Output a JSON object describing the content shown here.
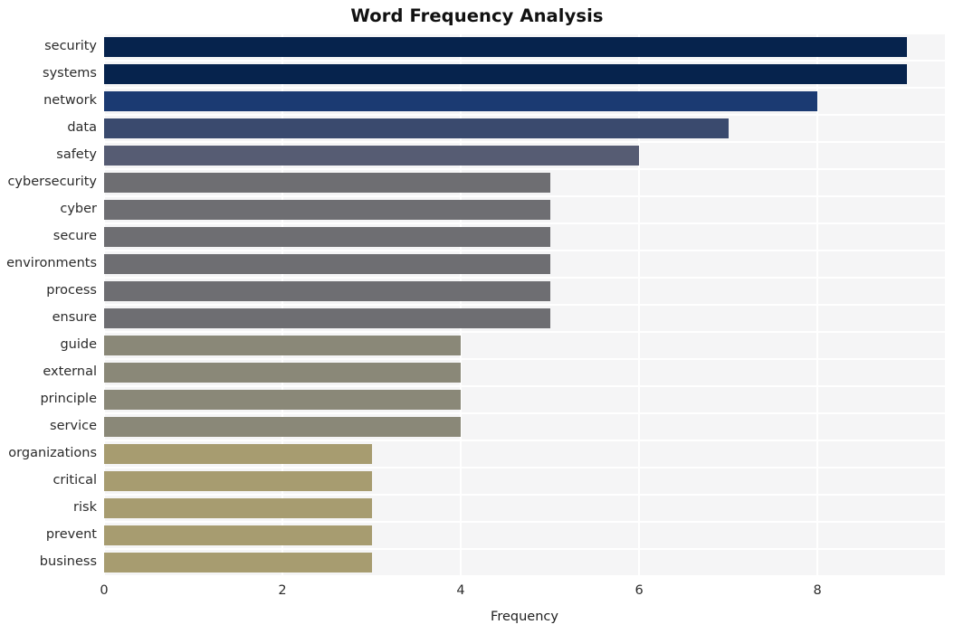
{
  "chart_data": {
    "type": "bar",
    "orientation": "horizontal",
    "title": "Word Frequency Analysis",
    "xlabel": "Frequency",
    "ylabel": "",
    "categories": [
      "security",
      "systems",
      "network",
      "data",
      "safety",
      "cybersecurity",
      "cyber",
      "secure",
      "environments",
      "process",
      "ensure",
      "guide",
      "external",
      "principle",
      "service",
      "organizations",
      "critical",
      "risk",
      "prevent",
      "business"
    ],
    "values": [
      9,
      9,
      8,
      7,
      6,
      5,
      5,
      5,
      5,
      5,
      5,
      4,
      4,
      4,
      4,
      3,
      3,
      3,
      3,
      3
    ],
    "bar_colors": [
      "#06234d",
      "#06234d",
      "#1b3a72",
      "#3a4a6e",
      "#565c73",
      "#6e6e72",
      "#6e6e72",
      "#6e6e72",
      "#6e6e72",
      "#6e6e72",
      "#6e6e72",
      "#8a8878",
      "#8a8878",
      "#8a8878",
      "#8a8878",
      "#a79c70",
      "#a79c70",
      "#a79c70",
      "#a79c70",
      "#a79c70"
    ],
    "xlim": [
      0,
      9.43
    ],
    "xticks": [
      0,
      2,
      4,
      6,
      8
    ],
    "xtick_labels": [
      "0",
      "2",
      "4",
      "6",
      "8"
    ],
    "grid": true,
    "grid_color": "#ffffff",
    "plot_background": "#f5f5f6",
    "figure_background": "#ffffff",
    "legend": "none"
  }
}
